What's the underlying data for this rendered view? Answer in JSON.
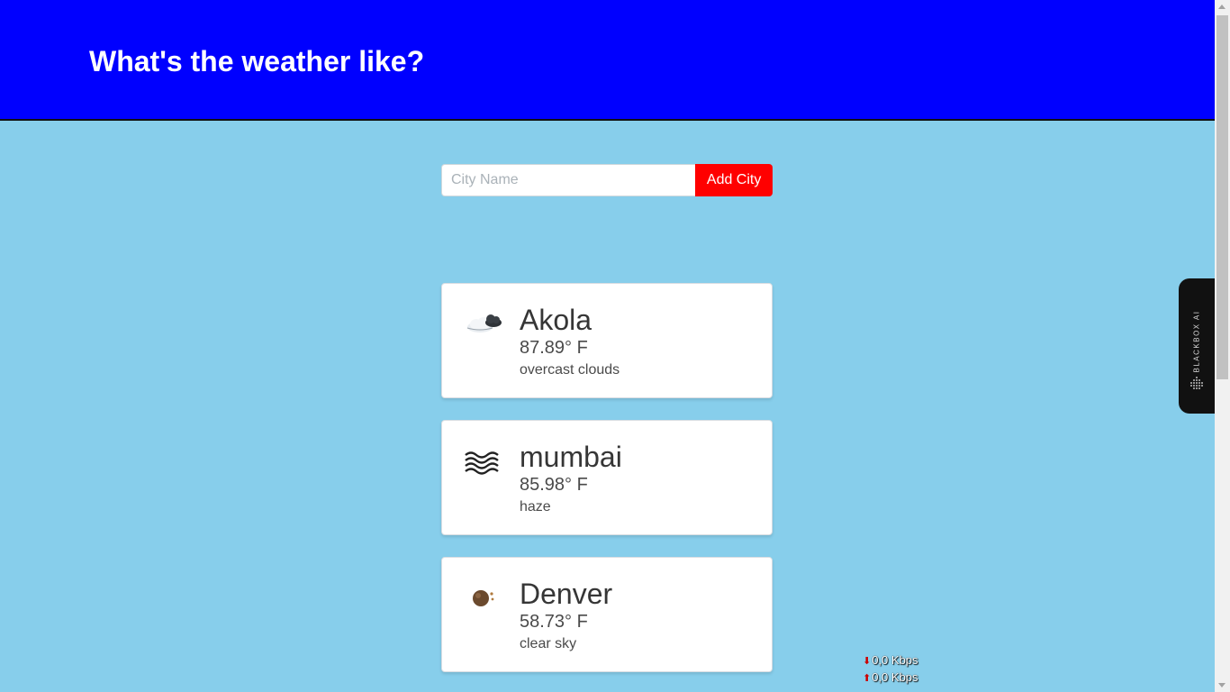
{
  "header": {
    "title": "What's the weather like?"
  },
  "search": {
    "placeholder": "City Name",
    "value": "",
    "button_label": "Add City"
  },
  "cities": [
    {
      "name": "Akola",
      "temperature": "87.89° F",
      "description": "overcast clouds",
      "icon": "overcast-clouds-icon"
    },
    {
      "name": "mumbai",
      "temperature": "85.98° F",
      "description": "haze",
      "icon": "haze-icon"
    },
    {
      "name": "Denver",
      "temperature": "58.73° F",
      "description": "clear sky",
      "icon": "clear-sky-icon"
    }
  ],
  "sidebar_widget": {
    "label": "BLACKBOX AI"
  },
  "netspeed": {
    "download": "0,0 Kbps",
    "upload": "0,0 Kbps"
  },
  "colors": {
    "header_bg": "#0000ff",
    "page_bg": "#87ceeb",
    "button_bg": "#ff0000"
  }
}
